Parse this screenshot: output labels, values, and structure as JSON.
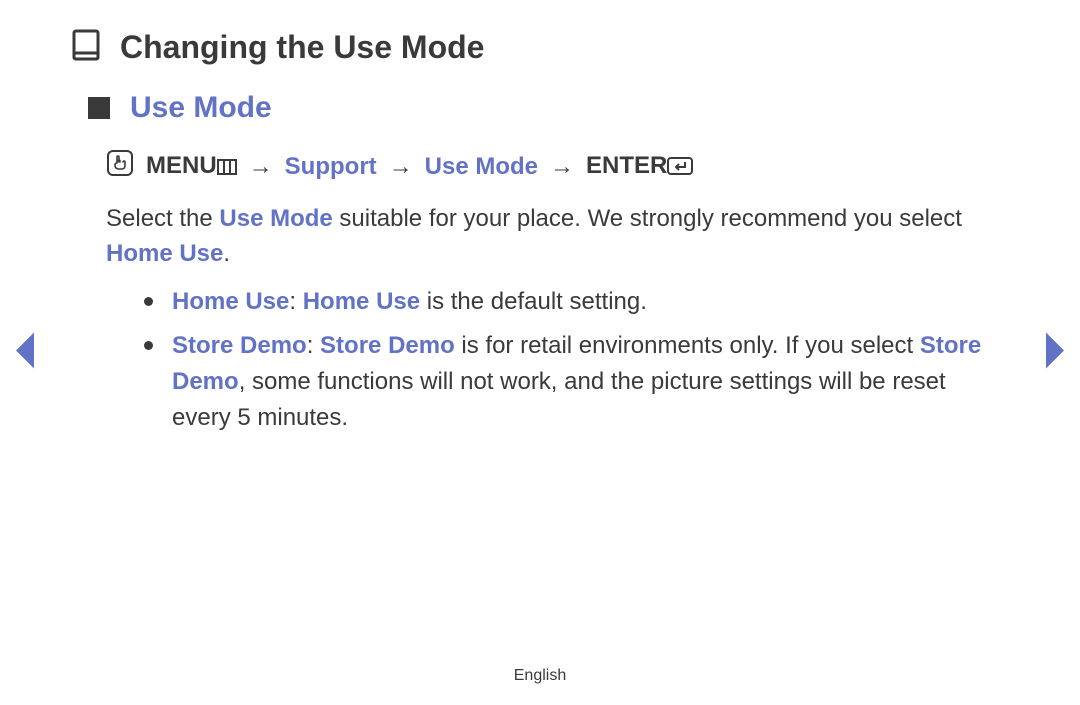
{
  "title": "Changing the Use Mode",
  "section_title": "Use Mode",
  "nav": {
    "menu": "MENU",
    "step1": "Support",
    "step2": "Use Mode",
    "enter": "ENTER",
    "arrow": "→"
  },
  "intro": {
    "pre": "Select the ",
    "use_mode": "Use Mode",
    "mid": " suitable for your place. We strongly recommend you select ",
    "home_use": "Home Use",
    "post": "."
  },
  "bullets": {
    "home": {
      "label1": "Home Use",
      "colon": ": ",
      "label2": "Home Use",
      "rest": " is the default setting."
    },
    "store": {
      "label1": "Store Demo",
      "colon": ": ",
      "label2": "Store Demo",
      "mid": " is for retail environments only. If you select ",
      "label3": "Store Demo",
      "rest": ", some functions will not work, and the picture settings will be reset every 5 minutes."
    }
  },
  "footer_language": "English",
  "colors": {
    "accent": "#6272c6",
    "text": "#3a3a3a"
  }
}
